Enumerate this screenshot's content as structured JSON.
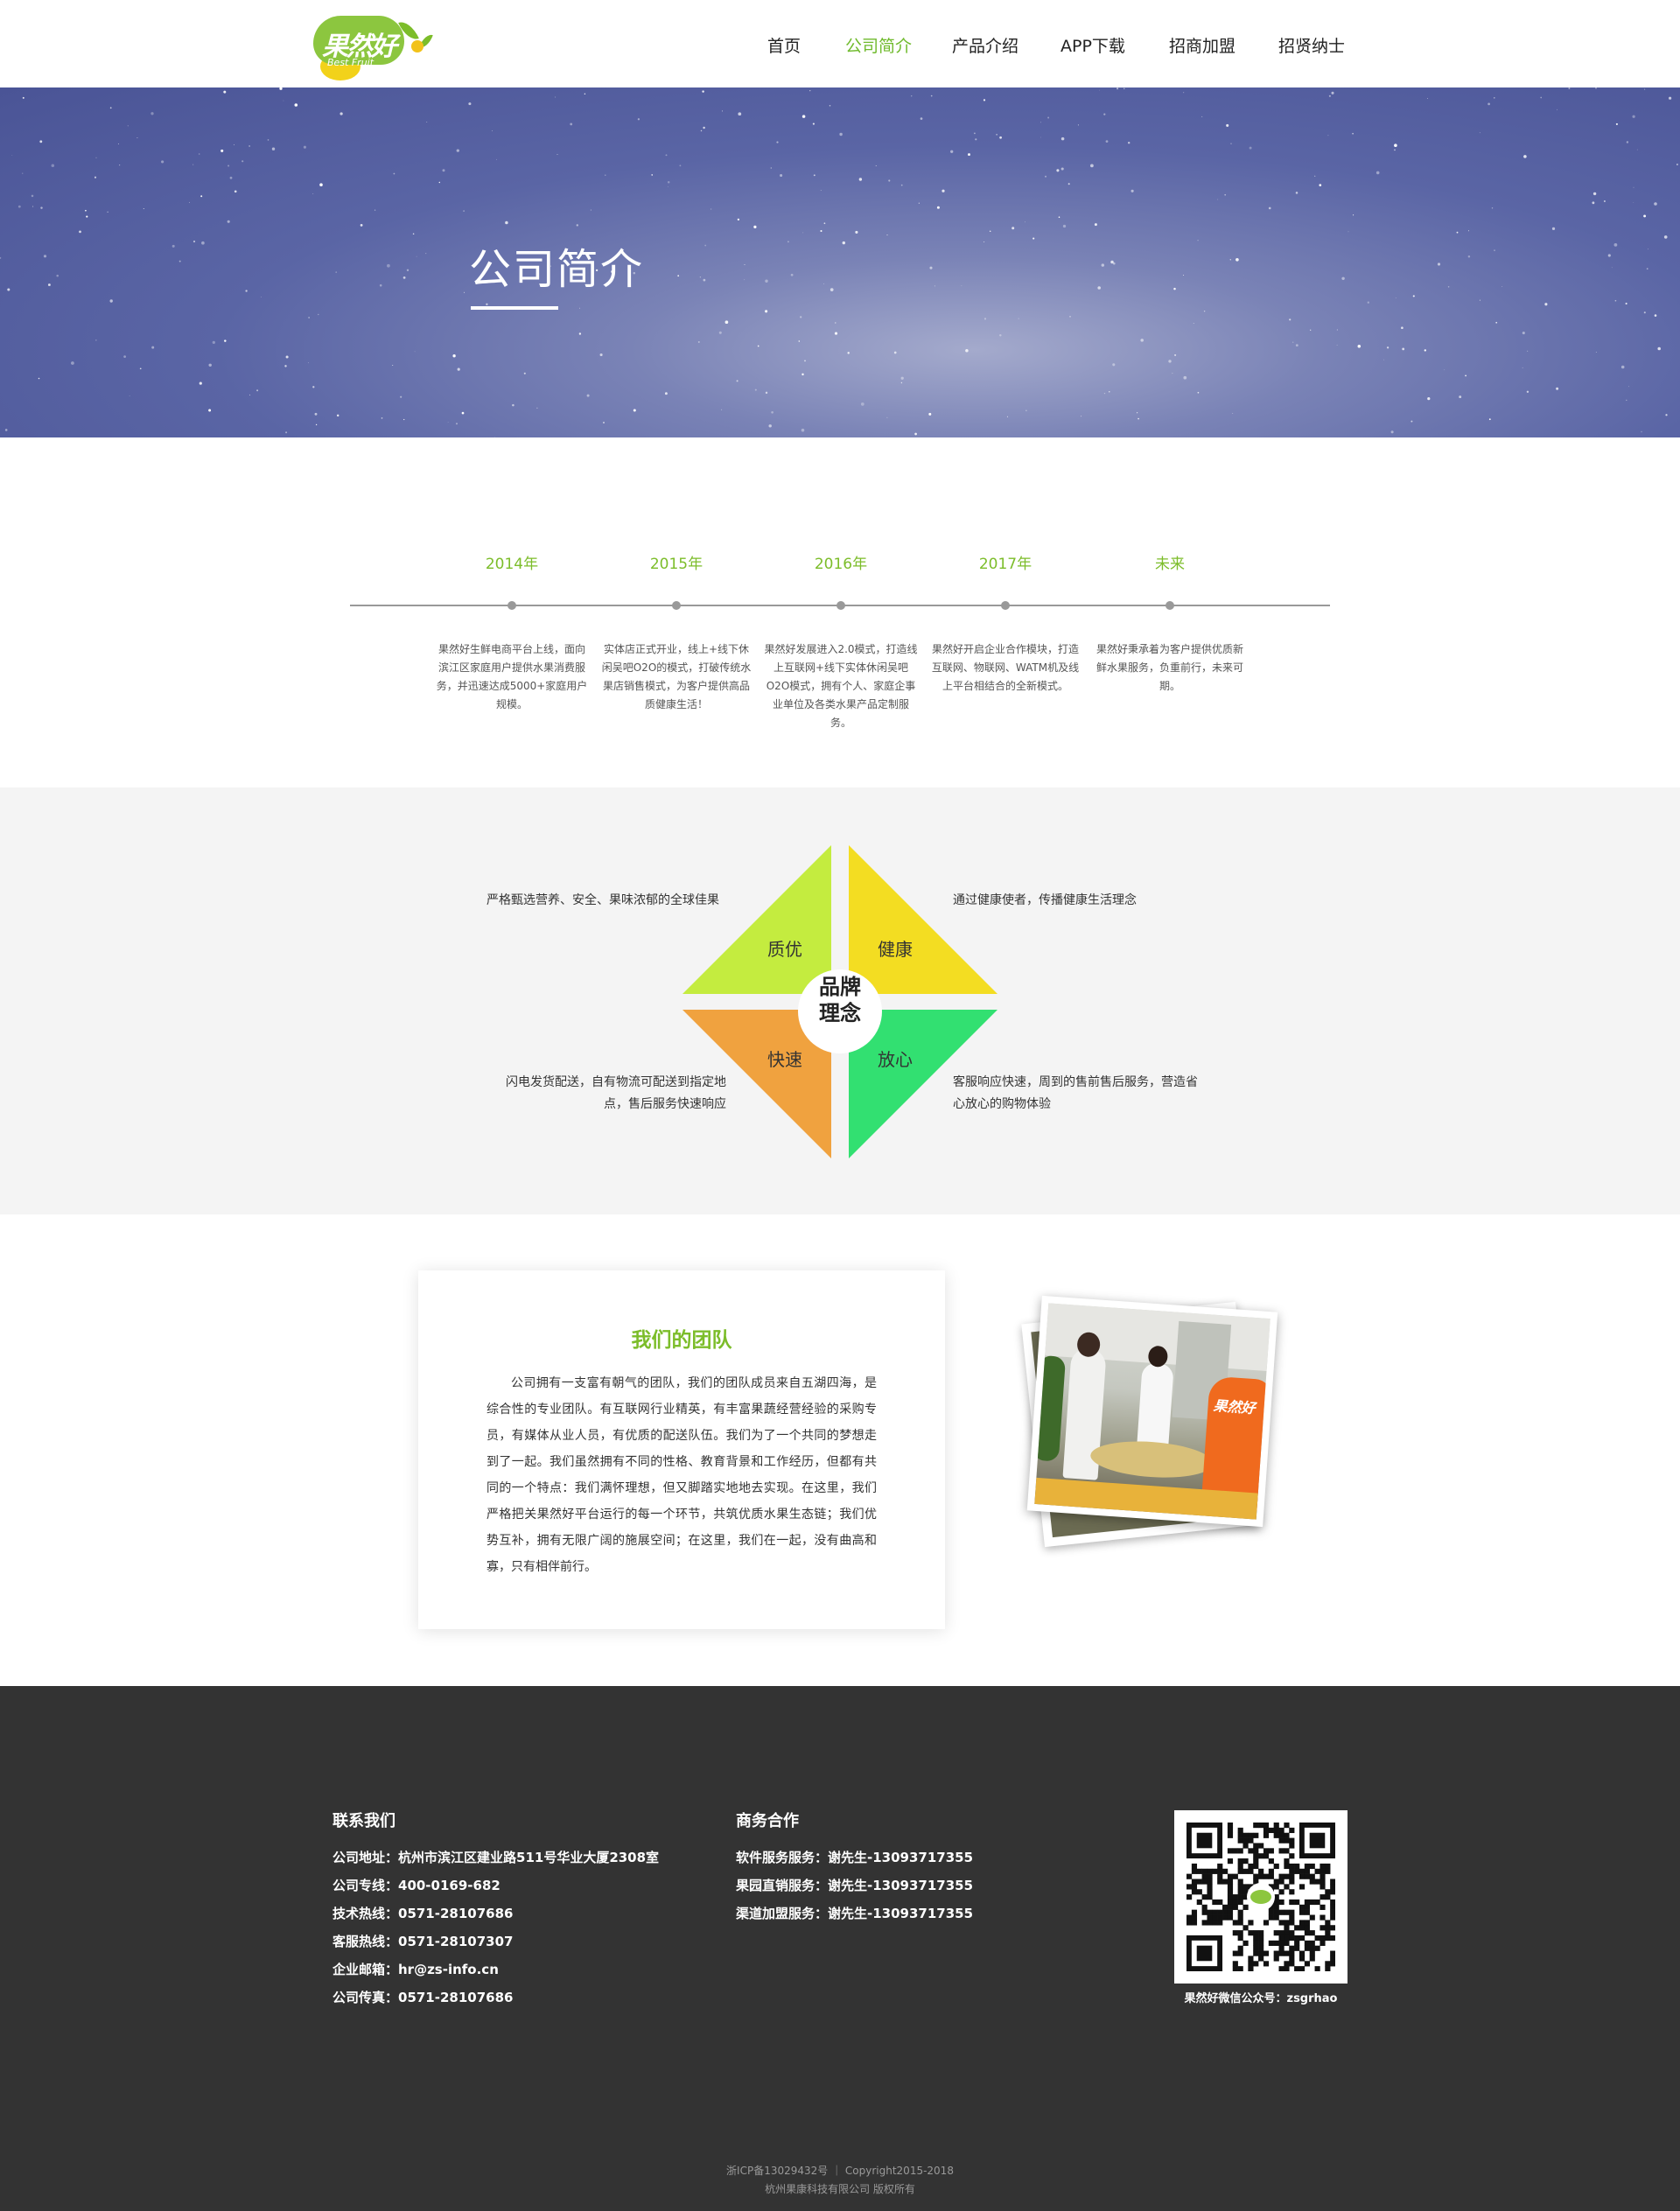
{
  "header": {
    "logo_text": "果然好",
    "logo_sub": "Best Fruit",
    "nav": [
      {
        "label": "首页",
        "active": false
      },
      {
        "label": "公司简介",
        "active": true
      },
      {
        "label": "产品介绍",
        "active": false
      },
      {
        "label": "APP下载",
        "active": false
      },
      {
        "label": "招商加盟",
        "active": false
      },
      {
        "label": "招贤纳士",
        "active": false
      }
    ]
  },
  "banner": {
    "title": "公司简介"
  },
  "timeline": {
    "items": [
      {
        "year": "2014年",
        "desc": "果然好生鲜电商平台上线，面向滨江区家庭用户提供水果消费服务，并迅速达成5000+家庭用户规模。"
      },
      {
        "year": "2015年",
        "desc": "实体店正式开业，线上+线下休闲吴吧O2O的模式，打破传统水果店销售模式，为客户提供高品质健康生活！"
      },
      {
        "year": "2016年",
        "desc": "果然好发展进入2.0模式，打造线上互联网+线下实体休闲吴吧O2O模式，拥有个人、家庭企事业单位及各类水果产品定制服务。"
      },
      {
        "year": "2017年",
        "desc": "果然好开启企业合作模块，打造互联网、物联网、WATM机及线上平台相结合的全新模式。"
      },
      {
        "year": "未来",
        "desc": "果然好秉承着为客户提供优质新鲜水果服务，负重前行，未来可期。"
      }
    ]
  },
  "concept": {
    "center_line1": "品牌",
    "center_line2": "理念",
    "quadrants": [
      {
        "label": "质优",
        "color": "#c4ec3f",
        "desc": "严格甄选营养、安全、果味浓郁的全球佳果"
      },
      {
        "label": "健康",
        "color": "#f3dd22",
        "desc": "通过健康使者，传播健康生活理念"
      },
      {
        "label": "快速",
        "color": "#f0a23f",
        "desc": "闪电发货配送，自有物流可配送到指定地点，售后服务快速响应"
      },
      {
        "label": "放心",
        "color": "#32e071",
        "desc": "客服响应快速，周到的售前售后服务，营造省心放心的购物体验"
      }
    ]
  },
  "team": {
    "title": "我们的团队",
    "body": "公司拥有一支富有朝气的团队，我们的团队成员来自五湖四海，是综合性的专业团队。有互联网行业精英，有丰富果蔬经营经验的采购专员，有媒体从业人员，有优质的配送队伍。我们为了一个共同的梦想走到了一起。我们虽然拥有不同的性格、教育背景和工作经历，但都有共同的一个特点：我们满怀理想，但又脚踏实地地去实现。在这里，我们严格把关果然好平台运行的每一个环节，共筑优质水果生态链；我们优势互补，拥有无限广阔的施展空间；在这里，我们在一起，没有曲高和寡，只有相伴前行。",
    "photo_shirt_text": "果然好"
  },
  "footer": {
    "contact_title": "联系我们",
    "contact_lines": [
      "公司地址：杭州市滨江区建业路511号华业大厦2308室",
      "公司专线：400-0169-682",
      "技术热线：0571-28107686",
      "客服热线：0571-28107307",
      "企业邮箱：hr@zs-info.cn",
      "公司传真：0571-28107686"
    ],
    "business_title": "商务合作",
    "business_lines": [
      "软件服务服务：谢先生-13093717355",
      "果园直销服务：谢先生-13093717355",
      "渠道加盟服务：谢先生-13093717355"
    ],
    "qr_caption": "果然好微信公众号：zsgrhao",
    "icp": "浙ICP备13029432号 ｜ Copyright2015-2018",
    "copyright": "杭州果康科技有限公司 版权所有"
  }
}
